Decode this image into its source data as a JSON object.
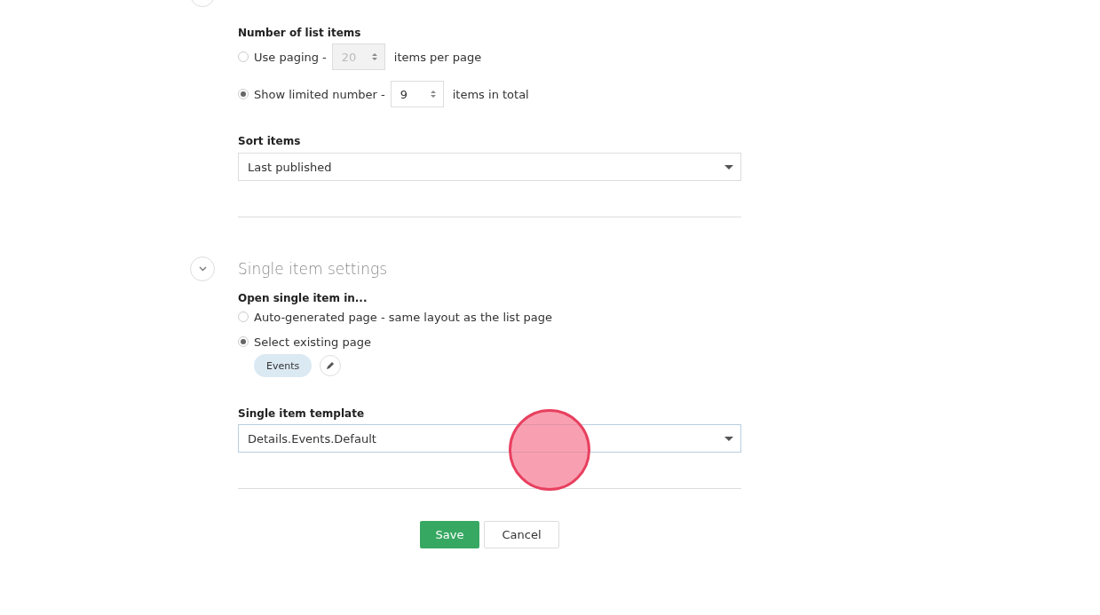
{
  "list_settings": {
    "number_label": "Number of list items",
    "options": [
      {
        "label": "Use paging -",
        "value": "20",
        "suffix": "items per page",
        "selected": false,
        "disabled": true
      },
      {
        "label": "Show limited number -",
        "value": "9",
        "suffix": "items in total",
        "selected": true,
        "disabled": false
      }
    ],
    "sort_label": "Sort items",
    "sort_value": "Last published"
  },
  "single_item_settings": {
    "title": "Single item settings",
    "expanded": true,
    "open_label": "Open single item in...",
    "options": [
      {
        "label": "Auto-generated page - same layout as the list page",
        "selected": false
      },
      {
        "label": "Select existing page",
        "selected": true
      }
    ],
    "page_chip": "Events",
    "template_label": "Single item template",
    "template_value": "Details.Events.Default"
  },
  "buttons": {
    "save": "Save",
    "cancel": "Cancel"
  }
}
